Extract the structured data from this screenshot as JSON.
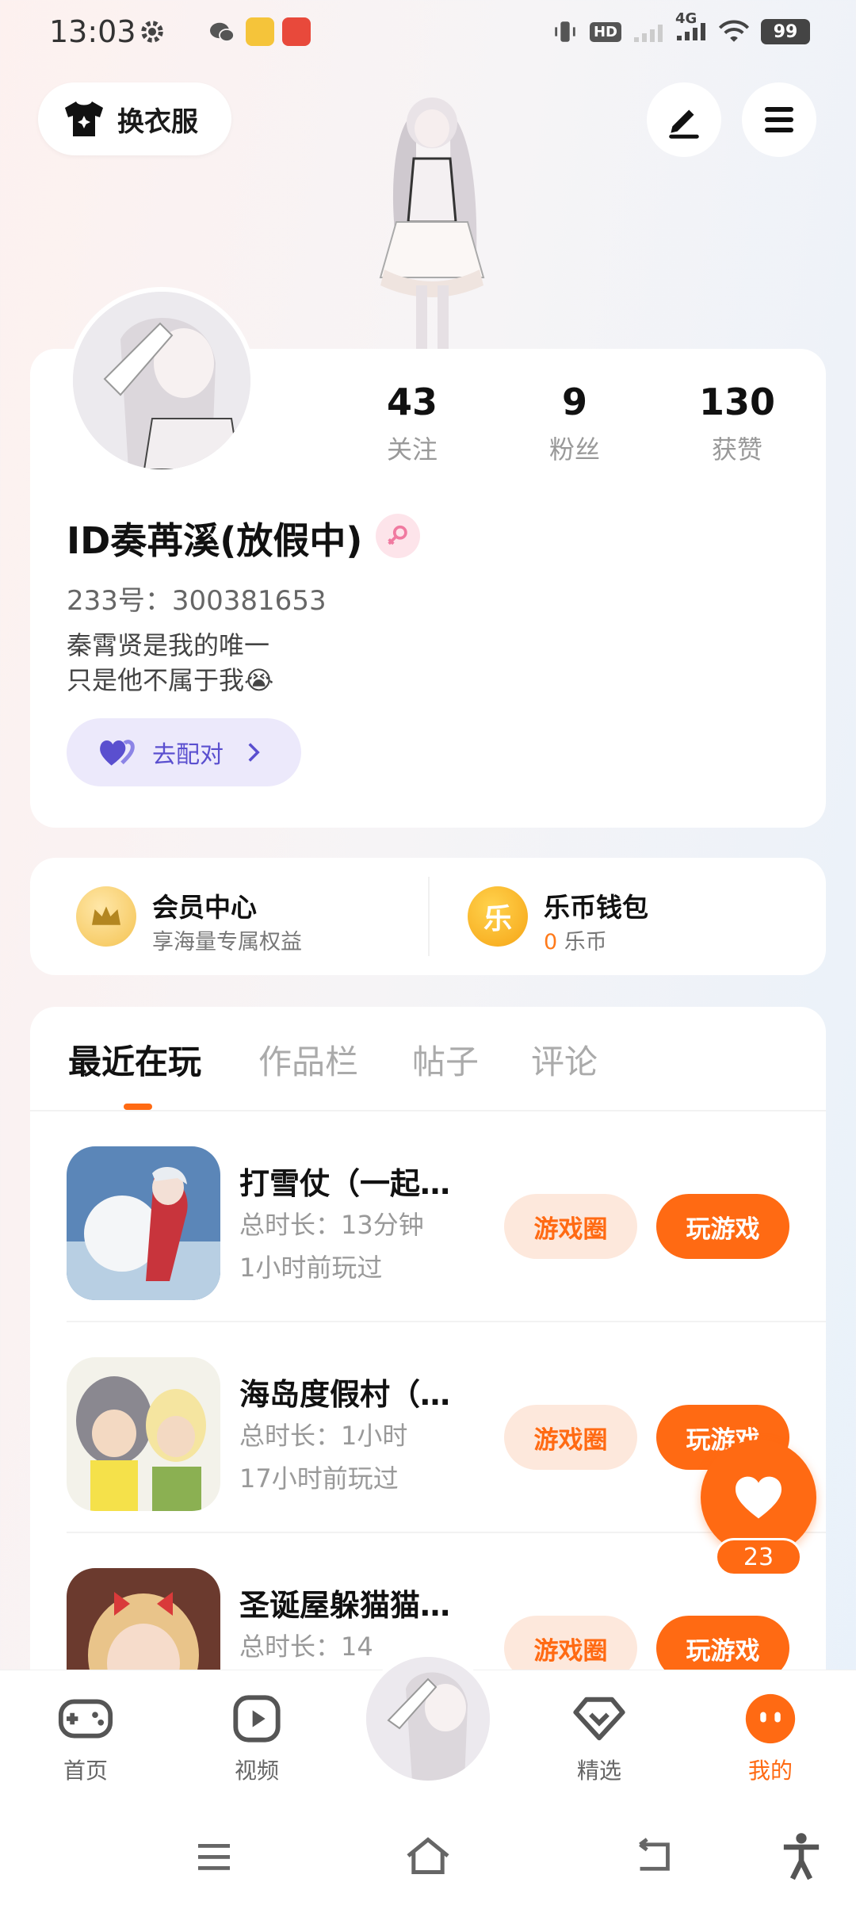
{
  "status_bar": {
    "time": "13:03",
    "hd_label": "HD",
    "network": "4G",
    "battery": "99"
  },
  "header": {
    "dress_up_label": "换衣服",
    "dress_up_icon": "shirt-icon",
    "edit_icon": "edit-icon",
    "menu_icon": "menu-icon"
  },
  "profile": {
    "stats": [
      {
        "value": "43",
        "label": "关注"
      },
      {
        "value": "9",
        "label": "粉丝"
      },
      {
        "value": "130",
        "label": "获赞"
      }
    ],
    "name": "ID奏苒溪(放假中)",
    "gender_icon": "female-icon",
    "uid": "233号：300381653",
    "bio_line1": "秦霄贤是我的唯一",
    "bio_line2": "只是他不属于我😭",
    "match_label": "去配对"
  },
  "member": {
    "vip_title": "会员中心",
    "vip_sub": "享海量专属权益",
    "coin_glyph": "乐",
    "coin_title": "乐币钱包",
    "coin_amount": "0",
    "coin_unit": "乐币"
  },
  "tabs": [
    "最近在玩",
    "作品栏",
    "帖子",
    "评论"
  ],
  "games": [
    {
      "title": "打雪仗（一起…",
      "duration": "总时长：13分钟",
      "last_played": "1小时前玩过",
      "circle_label": "游戏圈",
      "play_label": "玩游戏"
    },
    {
      "title": "海岛度假村（…",
      "duration": "总时长：1小时",
      "last_played": "17小时前玩过",
      "circle_label": "游戏圈",
      "play_label": "玩游戏"
    },
    {
      "title": "圣诞屋躲猫猫…",
      "duration": "总时长：14",
      "last_played": "",
      "circle_label": "游戏圈",
      "play_label": "玩游戏"
    }
  ],
  "float_like": {
    "count": "23"
  },
  "bottom_nav": [
    {
      "label": "首页",
      "icon": "gamepad-icon"
    },
    {
      "label": "视频",
      "icon": "video-icon"
    },
    {
      "label": "精选",
      "icon": "heart-diamond-icon"
    },
    {
      "label": "我的",
      "icon": "profile-face-icon"
    }
  ],
  "colors": {
    "accent": "#ff6a13",
    "accent_light": "#fde8dc",
    "match_bg": "#ece9fb",
    "match_text": "#5a4fcf"
  }
}
